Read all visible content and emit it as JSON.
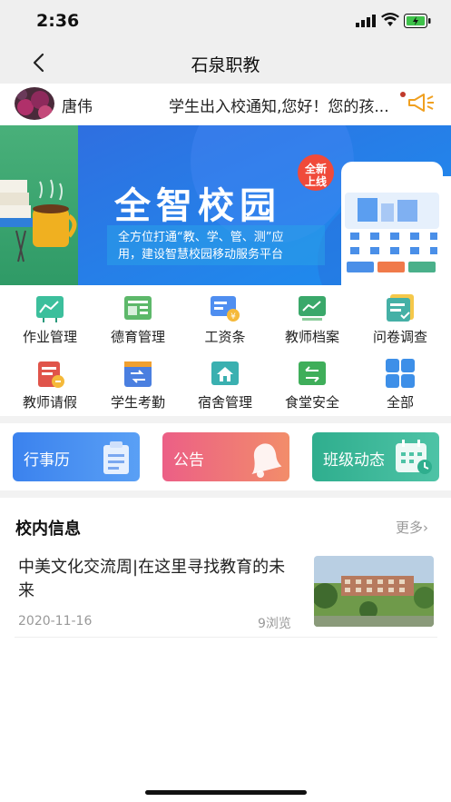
{
  "status": {
    "time": "2:36"
  },
  "nav": {
    "title": "石泉职教"
  },
  "user": {
    "name": "唐伟",
    "notice": "学生出入校通知,您好！您的孩..."
  },
  "banner": {
    "title": "全智校园",
    "badge_line1": "全新",
    "badge_line2": "上线",
    "subtitle_line1": "全方位打通“教、学、管、测”应",
    "subtitle_line2": "用，建设智慧校园移动服务平台"
  },
  "grid": [
    {
      "label": "作业管理",
      "icon": "homework-icon",
      "color": "#3cbf9c"
    },
    {
      "label": "德育管理",
      "icon": "moral-education-icon",
      "color": "#5db86a"
    },
    {
      "label": "工资条",
      "icon": "payslip-icon",
      "color": "#4f8ef0"
    },
    {
      "label": "教师档案",
      "icon": "teacher-archive-icon",
      "color": "#3aa86a"
    },
    {
      "label": "问卷调查",
      "icon": "survey-icon",
      "color": "#45b0a6"
    },
    {
      "label": "教师请假",
      "icon": "leave-icon",
      "color": "#e0544a"
    },
    {
      "label": "学生考勤",
      "icon": "attendance-icon",
      "color": "#4a7fe0"
    },
    {
      "label": "宿舍管理",
      "icon": "dormitory-icon",
      "color": "#3ab0b0"
    },
    {
      "label": "食堂安全",
      "icon": "canteen-icon",
      "color": "#3fae5a"
    },
    {
      "label": "全部",
      "icon": "all-apps-icon",
      "color": "#3d8fe8"
    }
  ],
  "cards": [
    {
      "label": "行事历",
      "icon": "clipboard-icon"
    },
    {
      "label": "公告",
      "icon": "bell-icon"
    },
    {
      "label": "班级动态",
      "icon": "calendar-icon"
    }
  ],
  "news_section": {
    "title": "校内信息",
    "more": "更多›"
  },
  "news": [
    {
      "title": "中美文化交流周|在这里寻找教育的未来",
      "date": "2020-11-16",
      "views": "9浏览"
    }
  ]
}
